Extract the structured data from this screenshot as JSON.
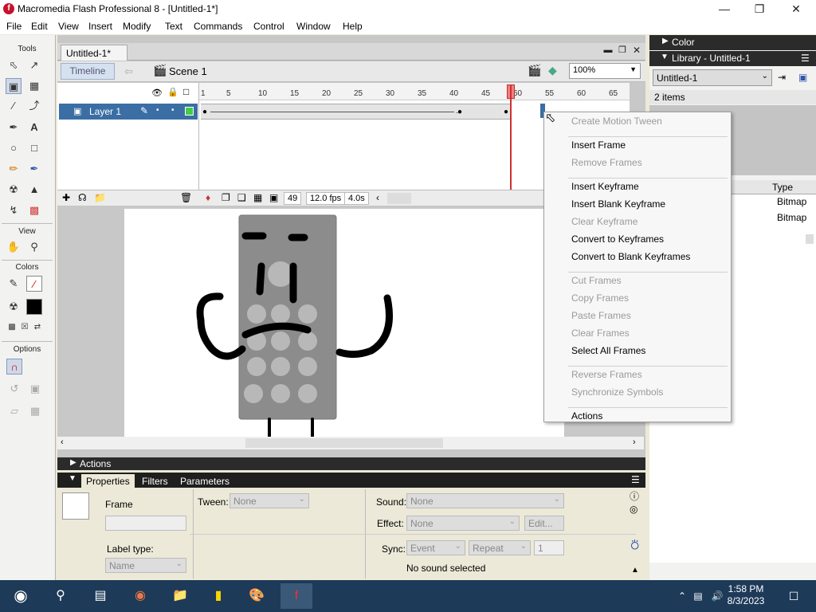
{
  "window": {
    "title": "Macromedia Flash Professional 8 - [Untitled-1*]"
  },
  "menu": [
    "File",
    "Edit",
    "View",
    "Insert",
    "Modify",
    "Text",
    "Commands",
    "Control",
    "Window",
    "Help"
  ],
  "tools": {
    "title": "Tools",
    "view_label": "View",
    "colors_label": "Colors",
    "options_label": "Options"
  },
  "document": {
    "tab": "Untitled-1*",
    "timeline_button": "Timeline",
    "scene": "Scene 1",
    "zoom": "100%"
  },
  "timeline": {
    "layer_name": "Layer 1",
    "ticks": [
      "1",
      "5",
      "10",
      "15",
      "20",
      "25",
      "30",
      "35",
      "40",
      "45",
      "50",
      "55",
      "60",
      "65"
    ],
    "current_frame": "49",
    "fps": "12.0 fps",
    "time": "4.0s"
  },
  "actions_panel": {
    "label": "Actions"
  },
  "properties": {
    "tabs": [
      "Properties",
      "Filters",
      "Parameters"
    ],
    "frame_label": "Frame",
    "tween_label": "Tween:",
    "tween_value": "None",
    "sound_label": "Sound:",
    "sound_value": "None",
    "effect_label": "Effect:",
    "effect_value": "None",
    "edit_button": "Edit...",
    "sync_label": "Sync:",
    "sync_value": "Event",
    "repeat_value": "Repeat",
    "repeat_count": "1",
    "label_type_label": "Label type:",
    "label_type_value": "Name",
    "no_sound": "No sound selected"
  },
  "right_panel": {
    "color_label": "Color",
    "library_label": "Library - Untitled-1",
    "library_select": "Untitled-1",
    "items_count": "2 items",
    "type_header": "Type",
    "items": [
      "Bitmap",
      "Bitmap"
    ]
  },
  "context_menu": [
    {
      "label": "Create Motion Tween",
      "enabled": false
    },
    {
      "sep": true
    },
    {
      "label": "Insert Frame",
      "enabled": true
    },
    {
      "label": "Remove Frames",
      "enabled": false
    },
    {
      "sep": true
    },
    {
      "label": "Insert Keyframe",
      "enabled": true
    },
    {
      "label": "Insert Blank Keyframe",
      "enabled": true
    },
    {
      "label": "Clear Keyframe",
      "enabled": false
    },
    {
      "label": "Convert to Keyframes",
      "enabled": true
    },
    {
      "label": "Convert to Blank Keyframes",
      "enabled": true
    },
    {
      "sep": true
    },
    {
      "label": "Cut Frames",
      "enabled": false
    },
    {
      "label": "Copy Frames",
      "enabled": false
    },
    {
      "label": "Paste Frames",
      "enabled": false
    },
    {
      "label": "Clear Frames",
      "enabled": false
    },
    {
      "label": "Select All Frames",
      "enabled": true
    },
    {
      "sep": true
    },
    {
      "label": "Reverse Frames",
      "enabled": false
    },
    {
      "label": "Synchronize Symbols",
      "enabled": false
    },
    {
      "sep": true
    },
    {
      "label": "Actions",
      "enabled": true
    }
  ],
  "taskbar": {
    "time": "1:58 PM",
    "date": "8/3/2023"
  },
  "colors": {
    "selection": "#3a6ea5",
    "playhead": "#d03030",
    "panel_header": "#2b2b2b",
    "taskbar": "#1d3a58"
  }
}
